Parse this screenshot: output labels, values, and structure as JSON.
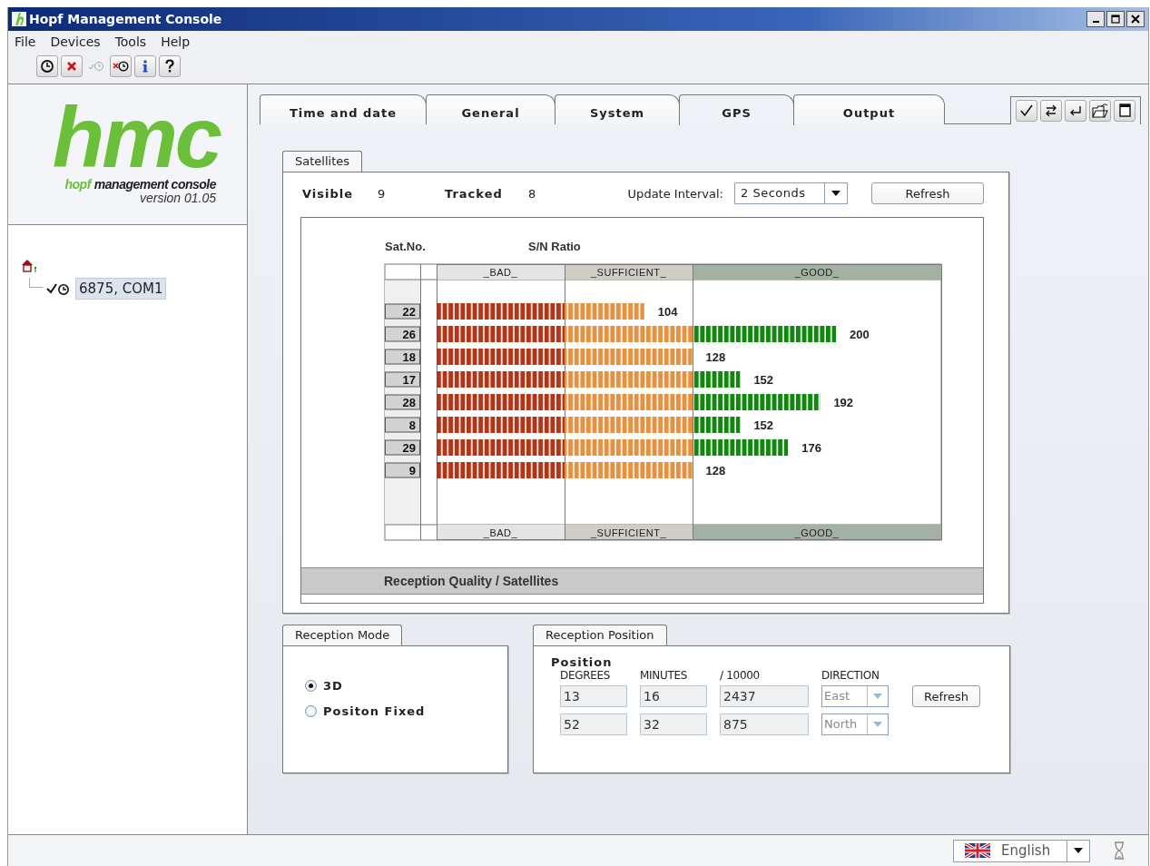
{
  "window": {
    "title": "Hopf Management Console"
  },
  "menu": [
    "File",
    "Devices",
    "Tools",
    "Help"
  ],
  "toolbar": [
    {
      "kind": "clock",
      "disabled": false
    },
    {
      "kind": "delete",
      "disabled": false
    },
    {
      "kind": "check-clock",
      "disabled": true
    },
    {
      "kind": "delete-clock",
      "disabled": false
    },
    {
      "kind": "info",
      "disabled": false
    },
    {
      "kind": "help",
      "disabled": false
    }
  ],
  "logo": {
    "mark": "hmc",
    "brand": "hopf",
    "tagline": "management console",
    "version": "version 01.05"
  },
  "tree": {
    "children": [
      {
        "label": "6875, COM1",
        "selected": true
      }
    ]
  },
  "tabs": [
    {
      "label": "Time and date",
      "selected": false
    },
    {
      "label": "General",
      "selected": false
    },
    {
      "label": "System",
      "selected": false
    },
    {
      "label": "GPS",
      "selected": true
    },
    {
      "label": "Output",
      "selected": false
    }
  ],
  "satellites": {
    "title": "Satellites",
    "visible_label": "Visible",
    "visible": "9",
    "tracked_label": "Tracked",
    "tracked": "8",
    "interval_label": "Update Interval:",
    "interval": "2 Seconds",
    "refresh": "Refresh",
    "chart_data": {
      "type": "bar",
      "orientation": "horizontal",
      "ylabel": "Sat.No.",
      "xlabel": "S/N Ratio",
      "categories": [
        "22",
        "26",
        "18",
        "17",
        "28",
        "8",
        "29",
        "9"
      ],
      "values": [
        104,
        200,
        128,
        152,
        192,
        152,
        176,
        128
      ],
      "data_labels": true
    },
    "zone_header": [
      "_BAD_",
      "_SUFFICIENT_",
      "_GOOD_"
    ],
    "zone_footer": [
      "_BAD_",
      "_SUFFICIENT_",
      "_GOOD_"
    ],
    "caption": "Reception Quality / Satellites"
  },
  "reception_mode": {
    "title": "Reception Mode",
    "options": [
      {
        "label": "3D",
        "selected": true
      },
      {
        "label": "Positon Fixed",
        "selected": false
      }
    ]
  },
  "reception_position": {
    "title": "Reception Position",
    "heading": "Position",
    "disabled": true,
    "columns": [
      "DEGREES",
      "MINUTES",
      "/ 10000",
      "DIRECTION"
    ],
    "rows": [
      {
        "degrees": "13",
        "minutes": "16",
        "fraction": "2437",
        "direction": "East"
      },
      {
        "degrees": "52",
        "minutes": "32",
        "fraction": "875",
        "direction": "North"
      }
    ],
    "refresh": "Refresh"
  },
  "status_bar": {
    "language": "English"
  }
}
